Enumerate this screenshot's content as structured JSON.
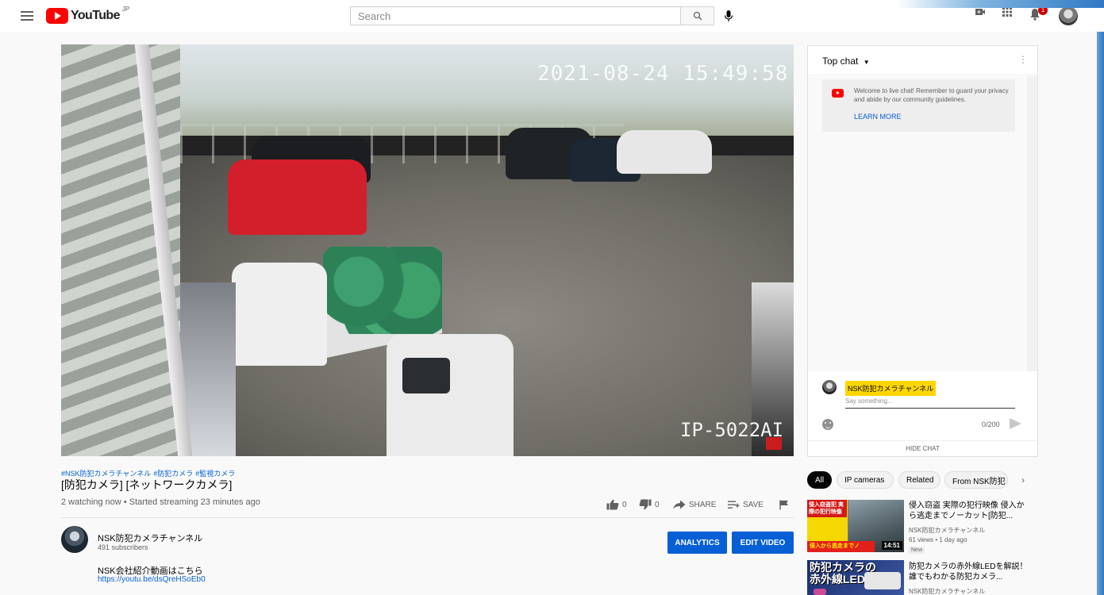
{
  "header": {
    "logo_text": "YouTube",
    "logo_region": "JP",
    "search_placeholder": "Search",
    "notification_count": "1"
  },
  "video": {
    "timestamp_overlay": "2021-08-24 15:49:58",
    "camera_model_overlay": "IP-5022AI"
  },
  "info": {
    "hashtags": [
      "#NSK防犯カメラチャンネル",
      "#防犯カメラ",
      "#監視カメラ"
    ],
    "title": "[防犯カメラ] [ネットワークカメラ]",
    "meta": "2 watching now • Started streaming 23 minutes ago",
    "likes": "0",
    "dislikes": "0",
    "share_label": "SHARE",
    "save_label": "SAVE"
  },
  "channel": {
    "name": "NSK防犯カメラチャンネル",
    "subscribers": "491 subscribers",
    "analytics_label": "ANALYTICS",
    "edit_label": "EDIT VIDEO",
    "description": "NSK会社紹介動画はこちら",
    "description_link": "https://youtu.be/dsQreHSoEb0"
  },
  "chat": {
    "title": "Top chat",
    "welcome_text": "Welcome to live chat! Remember to guard your privacy and abide by our community guidelines.",
    "learn_more": "LEARN MORE",
    "composer_name": "NSK防犯カメラチャンネル",
    "input_placeholder": "Say something...",
    "counter": "0/200",
    "hide_chat": "HIDE CHAT"
  },
  "chips": [
    "All",
    "IP cameras",
    "Related",
    "From NSK防犯"
  ],
  "recommendations": [
    {
      "title": "侵入窃盗 実際の犯行映像 侵入から逃走までノーカット[防犯...",
      "channel": "NSK防犯カメラチャンネル",
      "meta": "61 views • 1 day ago",
      "badge": "New",
      "duration": "14:51",
      "thumb_top_text": "侵入窃盗犯 実際の犯行映像",
      "thumb_bottom_text": "侵入から逃走までノ"
    },
    {
      "title": "防犯カメラの赤外線LEDを解説！誰でもわかる防犯カメラ...",
      "channel": "NSK防犯カメラチャンネル",
      "thumb_text_line1": "防犯カメラの",
      "thumb_text_line2": "赤外線LED"
    }
  ],
  "colors": {
    "youtube_red": "#ff0000",
    "link_blue": "#065fd4",
    "highlight_yellow": "#ffd600"
  }
}
